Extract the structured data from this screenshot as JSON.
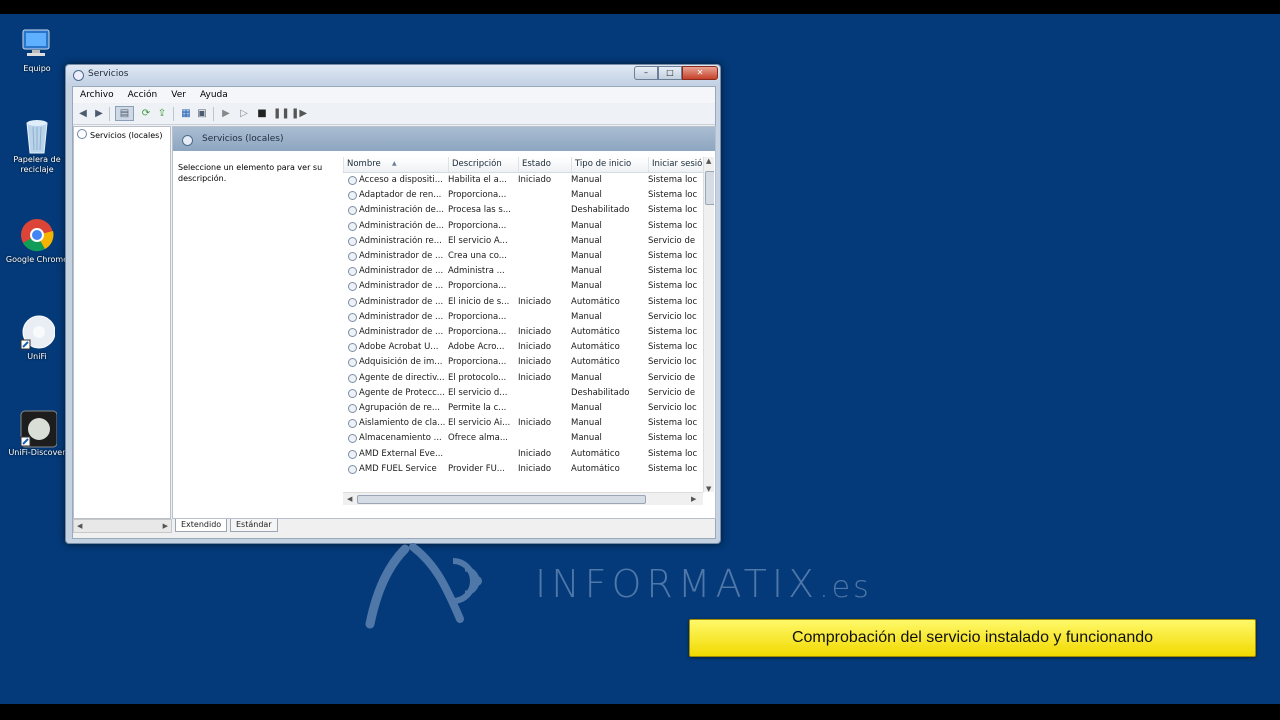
{
  "desktop_icons": [
    {
      "name": "equipo",
      "label": "Equipo"
    },
    {
      "name": "papelera",
      "label": "Papelera de\nreciclaje"
    },
    {
      "name": "chrome",
      "label": "Google Chrome"
    },
    {
      "name": "unifi",
      "label": "UniFi"
    },
    {
      "name": "unifi-discover",
      "label": "UniFi-Discover"
    }
  ],
  "window": {
    "title": "Servicios",
    "menu": [
      "Archivo",
      "Acción",
      "Ver",
      "Ayuda"
    ],
    "tree_item": "Servicios (locales)",
    "pane_title": "Servicios (locales)",
    "description": "Seleccione un elemento para ver su descripción.",
    "columns": [
      "Nombre",
      "Descripción",
      "Estado",
      "Tipo de inicio",
      "Iniciar sesió"
    ],
    "services": [
      {
        "name": "Acceso a dispositi...",
        "desc": "Habilita el a...",
        "state": "Iniciado",
        "start": "Manual",
        "logon": "Sistema loc"
      },
      {
        "name": "Adaptador de ren...",
        "desc": "Proporciona...",
        "state": "",
        "start": "Manual",
        "logon": "Sistema loc"
      },
      {
        "name": "Administración de...",
        "desc": "Procesa las s...",
        "state": "",
        "start": "Deshabilitado",
        "logon": "Sistema loc"
      },
      {
        "name": "Administración de...",
        "desc": "Proporciona...",
        "state": "",
        "start": "Manual",
        "logon": "Sistema loc"
      },
      {
        "name": "Administración re...",
        "desc": "El servicio A...",
        "state": "",
        "start": "Manual",
        "logon": "Servicio de"
      },
      {
        "name": "Administrador de ...",
        "desc": "Crea una co...",
        "state": "",
        "start": "Manual",
        "logon": "Sistema loc"
      },
      {
        "name": "Administrador de ...",
        "desc": "Administra ...",
        "state": "",
        "start": "Manual",
        "logon": "Sistema loc"
      },
      {
        "name": "Administrador de ...",
        "desc": "Proporciona...",
        "state": "",
        "start": "Manual",
        "logon": "Sistema loc"
      },
      {
        "name": "Administrador de ...",
        "desc": "El inicio de s...",
        "state": "Iniciado",
        "start": "Automático",
        "logon": "Sistema loc"
      },
      {
        "name": "Administrador de ...",
        "desc": "Proporciona...",
        "state": "",
        "start": "Manual",
        "logon": "Servicio loc"
      },
      {
        "name": "Administrador de ...",
        "desc": "Proporciona...",
        "state": "Iniciado",
        "start": "Automático",
        "logon": "Sistema loc"
      },
      {
        "name": "Adobe Acrobat U...",
        "desc": "Adobe Acro...",
        "state": "Iniciado",
        "start": "Automático",
        "logon": "Sistema loc"
      },
      {
        "name": "Adquisición de im...",
        "desc": "Proporciona...",
        "state": "Iniciado",
        "start": "Automático",
        "logon": "Servicio loc"
      },
      {
        "name": "Agente de directiv...",
        "desc": "El protocolo...",
        "state": "Iniciado",
        "start": "Manual",
        "logon": "Servicio de"
      },
      {
        "name": "Agente de Protecc...",
        "desc": "El servicio d...",
        "state": "",
        "start": "Deshabilitado",
        "logon": "Servicio de"
      },
      {
        "name": "Agrupación de re...",
        "desc": "Permite la c...",
        "state": "",
        "start": "Manual",
        "logon": "Servicio loc"
      },
      {
        "name": "Aislamiento de cla...",
        "desc": "El servicio Ai...",
        "state": "Iniciado",
        "start": "Manual",
        "logon": "Sistema loc"
      },
      {
        "name": "Almacenamiento ...",
        "desc": "Ofrece alma...",
        "state": "",
        "start": "Manual",
        "logon": "Sistema loc"
      },
      {
        "name": "AMD External Eve...",
        "desc": "",
        "state": "Iniciado",
        "start": "Automático",
        "logon": "Sistema loc"
      },
      {
        "name": "AMD FUEL Service",
        "desc": "Provider FU...",
        "state": "Iniciado",
        "start": "Automático",
        "logon": "Sistema loc"
      }
    ],
    "tabs": [
      "Extendido",
      "Estándar"
    ]
  },
  "watermark": {
    "brand": "INFORMATIX",
    "tld": ".es"
  },
  "caption": "Comprobación del servicio instalado y funcionando"
}
